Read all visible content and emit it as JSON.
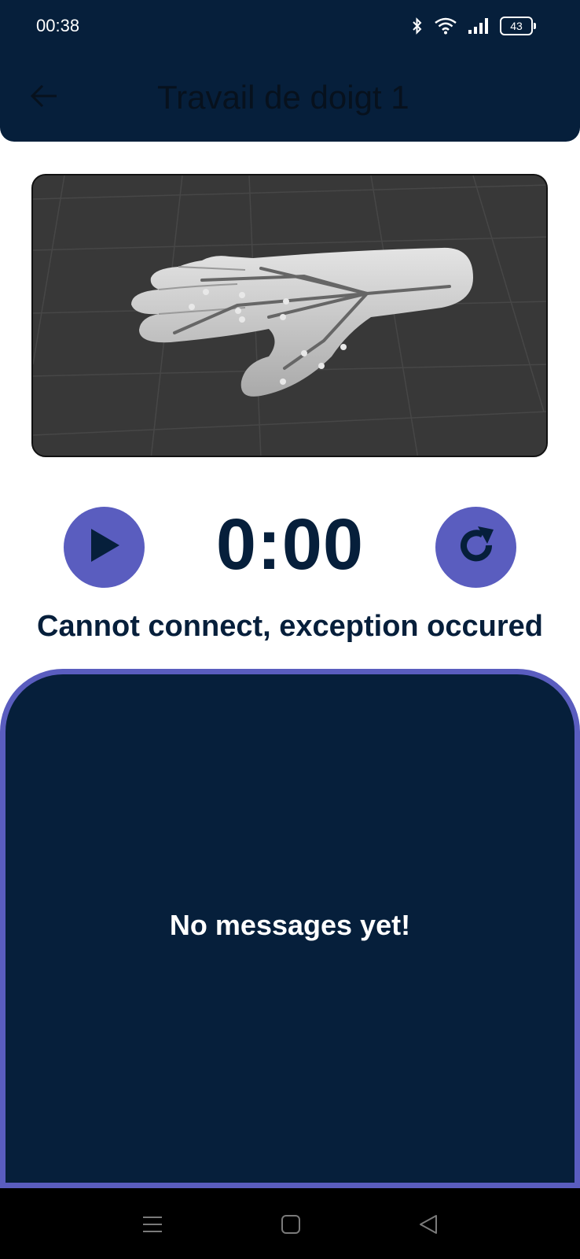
{
  "status_bar": {
    "time": "00:38",
    "battery": "43",
    "icons": [
      "bluetooth-icon",
      "wifi-icon",
      "signal-icon",
      "battery-icon"
    ]
  },
  "header": {
    "title": "Travail de doigt 1",
    "back_icon": "arrow-left-icon"
  },
  "viewer": {
    "content": "3d-hand-model"
  },
  "controls": {
    "play_icon": "play-icon",
    "timer": "0:00",
    "reset_icon": "refresh-icon"
  },
  "connection_status": "Cannot connect, exception occured",
  "messages": {
    "empty_text": "No messages yet!"
  },
  "navigation_bar": {
    "icons": [
      "menu-icon",
      "home-icon",
      "back-icon"
    ]
  },
  "colors": {
    "navy": "#061f3b",
    "accent": "#5a5dbf",
    "viewer_bg": "#383838"
  }
}
